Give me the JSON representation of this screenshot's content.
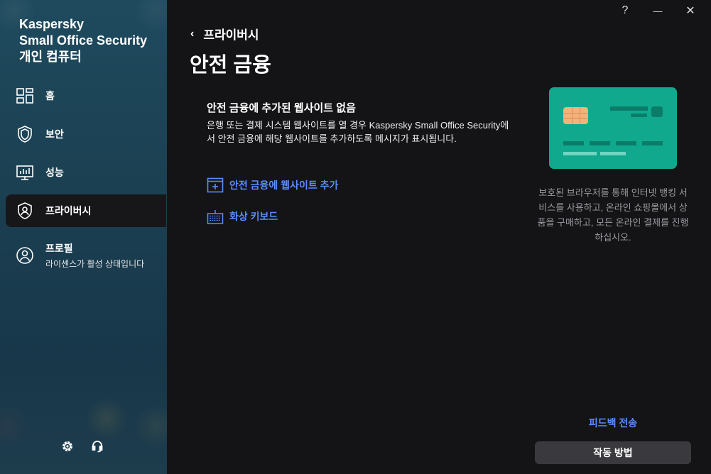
{
  "app": {
    "brand_line1": "Kaspersky",
    "brand_line2": "Small Office Security",
    "brand_line3": "개인 컴퓨터"
  },
  "window_buttons": {
    "help": "?",
    "minimize": "—",
    "close": "✕"
  },
  "sidebar": {
    "items": [
      {
        "label": "홈",
        "icon": "dashboard-grid-icon"
      },
      {
        "label": "보안",
        "icon": "shield-icon"
      },
      {
        "label": "성능",
        "icon": "performance-monitor-icon"
      },
      {
        "label": "프라이버시",
        "icon": "privacy-shield-user-icon"
      }
    ],
    "profile": {
      "label": "프로필",
      "sub": "라이센스가 활성 상태입니다",
      "icon": "user-circle-icon"
    },
    "bottom_icons": [
      "settings-gear-icon",
      "support-headset-icon"
    ]
  },
  "header": {
    "back_label": "프라이버시",
    "title": "안전 금융"
  },
  "main": {
    "empty_title": "안전 금융에 추가된 웹사이트 없음",
    "empty_desc": "은행 또는 결제 시스템 웹사이트를 열 경우 Kaspersky Small Office Security에서 안전 금융에 해당 웹사이트를 추가하도록 메시지가 표시됩니다.",
    "add_site_link": "안전 금융에 웹사이트 추가",
    "keyboard_link": "화상 키보드"
  },
  "side": {
    "description": "보호된 브라우저를 통해 인터넷 뱅킹 서비스를 사용하고, 온라인 쇼핑몰에서 상품을 구매하고, 모든 온라인 결제를 진행하십시오.",
    "feedback": "피드백 전송",
    "how_it_works": "작동 방법"
  },
  "colors": {
    "accent_link": "#5a8cff",
    "card": "#10a98e",
    "chip": "#f3b27a",
    "background": "#141417"
  }
}
